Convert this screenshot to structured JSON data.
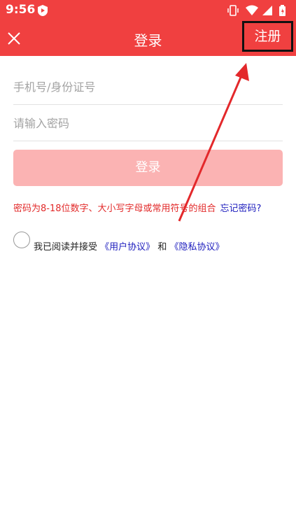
{
  "status_bar": {
    "time": "9:56",
    "icons": [
      "app-notification-icon",
      "vibrate-icon",
      "wifi-icon",
      "signal-icon",
      "battery-icon"
    ]
  },
  "header": {
    "title": "登录",
    "close_icon": "close-icon",
    "register_label": "注册"
  },
  "form": {
    "phone_placeholder": "手机号/身份证号",
    "password_placeholder": "请输入密码",
    "login_label": "登录"
  },
  "hint": {
    "text": "密码为8-18位数字、大小写字母或常用符号的组合",
    "forgot_label": "忘记密码?"
  },
  "agreement": {
    "prefix": "我已阅读并接受",
    "user_agreement": "《用户协议》",
    "conjunction": "和",
    "privacy_policy": "《隐私协议》"
  },
  "colors": {
    "brand": "#f04040",
    "login_button_disabled": "#fbb3b3",
    "link": "#1b1bbd",
    "hint": "#e22a2a"
  }
}
